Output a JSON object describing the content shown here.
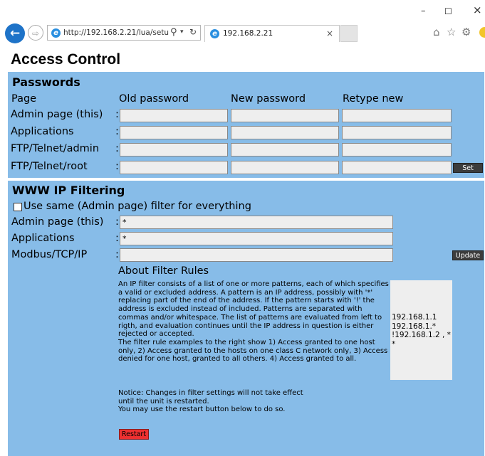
{
  "browser": {
    "url": "http://192.168.2.21/lua/setu|",
    "tab_title": "192.168.2.21",
    "controls": {
      "minimize": "–",
      "maximize": "☐",
      "close": "×"
    }
  },
  "page_title": "Access Control",
  "passwords": {
    "title": "Passwords",
    "headers": {
      "page": "Page",
      "old": "Old password",
      "new": "New password",
      "retype": "Retype new"
    },
    "rows": [
      {
        "label": "Admin page (this)",
        "colon": ":"
      },
      {
        "label": "Applications",
        "colon": ":"
      },
      {
        "label": "FTP/Telnet/admin",
        "colon": ":"
      },
      {
        "label": "FTP/Telnet/root",
        "colon": ":"
      }
    ],
    "set_label": "Set"
  },
  "ip_filter": {
    "title": "WWW IP Filtering",
    "same_filter_label": "Use same (Admin page) filter for everything",
    "same_filter_checked": false,
    "rows": [
      {
        "label": "Admin page (this)",
        "colon": ":",
        "value": "*"
      },
      {
        "label": "Applications",
        "colon": ":",
        "value": "*"
      },
      {
        "label": "Modbus/TCP/IP",
        "colon": ":",
        "value": ""
      }
    ],
    "update_label": "Update"
  },
  "about": {
    "title": "About Filter Rules",
    "paragraph_1": "An IP filter consists of a list of one or more patterns, each of which specifies a valid or excluded address. A pattern is an IP address, possibly with '*' replacing part of the end of the address. If the pattern starts with '!' the address is excluded instead of included. Patterns are separated with commas and/or whitespace. The list of patterns are evaluated from left to rigth, and evaluation continues until the IP address in question is either rejected or accepted.",
    "paragraph_2": "The filter rule examples to the right show 1) Access granted to one host only, 2) Access granted to the hosts on one class C network only, 3) Access denied for one host, granted to all others. 4) Access granted to all.",
    "examples": [
      "192.168.1.1",
      "192.168.1.*",
      "!192.168.1.2 , *",
      "*"
    ]
  },
  "notice": {
    "line_1": "Notice: Changes in filter settings will not take effect",
    "line_2": "until the unit is restarted.",
    "line_3": "You may use the restart button below to do so."
  },
  "restart_label": "Restart",
  "colors": {
    "section_bg": "#87bce8",
    "input_bg": "#eeeeee",
    "restart_bg": "#ee3030",
    "dark_button": "#3c3c3c"
  }
}
